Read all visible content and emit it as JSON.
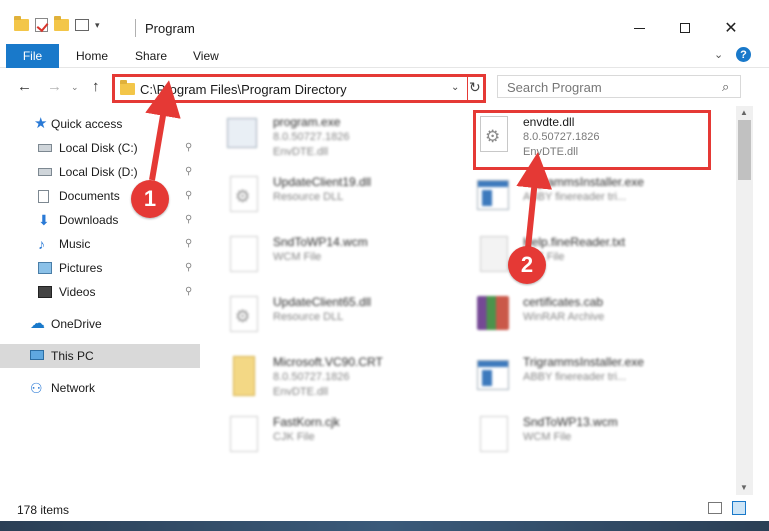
{
  "window": {
    "title": "Program",
    "minimize_icon": "minimize-icon",
    "maximize_icon": "maximize-icon",
    "close_glyph": "✕"
  },
  "ribbon": {
    "file": "File",
    "home": "Home",
    "share": "Share",
    "view": "View",
    "help": "?"
  },
  "nav": {
    "back": "←",
    "forward": "→",
    "recent": "⌄",
    "up": "↑",
    "address": "C:\\Program Files\\Program Directory",
    "address_dropdown": "⌄",
    "refresh": "↻",
    "search_placeholder": "Search Program",
    "search_icon": "⌕"
  },
  "sidebar": {
    "items": [
      {
        "label": "Quick access",
        "icon": "star-icon"
      },
      {
        "label": "Local Disk (C:)",
        "icon": "disk-icon",
        "pinned": true
      },
      {
        "label": "Local Disk (D:)",
        "icon": "disk-icon",
        "pinned": true
      },
      {
        "label": "Documents",
        "icon": "documents-icon",
        "pinned": true
      },
      {
        "label": "Downloads",
        "icon": "downloads-icon",
        "pinned": true
      },
      {
        "label": "Music",
        "icon": "music-icon",
        "pinned": true
      },
      {
        "label": "Pictures",
        "icon": "pictures-icon",
        "pinned": true
      },
      {
        "label": "Videos",
        "icon": "videos-icon",
        "pinned": true
      },
      {
        "label": "OneDrive",
        "icon": "cloud-icon"
      },
      {
        "label": "This PC",
        "icon": "computer-icon",
        "selected": true
      },
      {
        "label": "Network",
        "icon": "network-icon"
      }
    ],
    "pin_glyph": "📌"
  },
  "files": [
    {
      "name": "program.exe",
      "line2": "8.0.50727.1826",
      "line3": "EnvDTE.dll",
      "icon": "program-icon"
    },
    {
      "name": "envdte.dll",
      "line2": "8.0.50727.1826",
      "line3": "EnvDTE.dll",
      "icon": "dll-icon",
      "highlighted": true
    },
    {
      "name": "UpdateClient19.dll",
      "line2": "Resource DLL",
      "line3": "",
      "icon": "dll-icon"
    },
    {
      "name": "TrigrammsInstaller.exe",
      "line2": "ABBY finereader tri...",
      "line3": "",
      "icon": "exe-icon"
    },
    {
      "name": "SndToWP14.wcm",
      "line2": "WCM File",
      "line3": "",
      "icon": "file-icon"
    },
    {
      "name": "Help.fineReader.txt",
      "line2": "TXT File",
      "line3": "",
      "icon": "text-file-icon"
    },
    {
      "name": "UpdateClient65.dll",
      "line2": "Resource DLL",
      "line3": "",
      "icon": "dll-icon"
    },
    {
      "name": "certificates.cab",
      "line2": "WinRAR Archive",
      "line3": "",
      "icon": "archive-icon"
    },
    {
      "name": "Microsoft.VC90.CRT",
      "line2": "8.0.50727.1826",
      "line3": "EnvDTE.dll",
      "icon": "manifest-icon"
    },
    {
      "name": "TrigrammsInstaller.exe",
      "line2": "ABBY finereader tri...",
      "line3": "",
      "icon": "exe-icon"
    },
    {
      "name": "FastKorn.cjk",
      "line2": "CJK File",
      "line3": "",
      "icon": "file-icon"
    },
    {
      "name": "SndToWP13.wcm",
      "line2": "WCM File",
      "line3": "",
      "icon": "file-icon"
    }
  ],
  "status": {
    "items_count": "178 items"
  },
  "callouts": {
    "one": "1",
    "two": "2"
  },
  "colors": {
    "accent": "#1979ca",
    "highlight": "#e53935",
    "selected_bg": "#d9d9d9"
  }
}
